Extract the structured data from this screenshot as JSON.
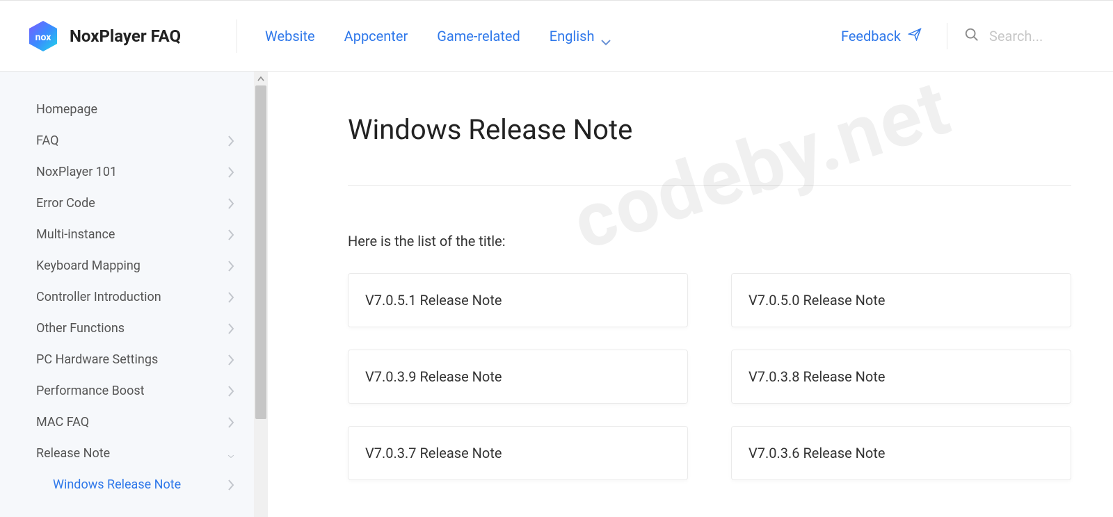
{
  "header": {
    "logo_text": "NoxPlayer FAQ",
    "nav": {
      "website": "Website",
      "appcenter": "Appcenter",
      "game_related": "Game-related",
      "language": "English"
    },
    "feedback": "Feedback",
    "search_placeholder": "Search..."
  },
  "sidebar": {
    "items": [
      {
        "label": "Homepage",
        "expandable": false
      },
      {
        "label": "FAQ",
        "expandable": true
      },
      {
        "label": "NoxPlayer 101",
        "expandable": true
      },
      {
        "label": "Error Code",
        "expandable": true
      },
      {
        "label": "Multi-instance",
        "expandable": true
      },
      {
        "label": "Keyboard Mapping",
        "expandable": true
      },
      {
        "label": "Controller Introduction",
        "expandable": true
      },
      {
        "label": "Other Functions",
        "expandable": true
      },
      {
        "label": "PC Hardware Settings",
        "expandable": true
      },
      {
        "label": "Performance Boost",
        "expandable": true
      },
      {
        "label": "MAC FAQ",
        "expandable": true
      },
      {
        "label": "Release Note",
        "expandable": true,
        "expanded": true
      }
    ],
    "sub_item": "Windows Release Note"
  },
  "main": {
    "title": "Windows Release Note",
    "intro": "Here is the list of the title:",
    "cards": [
      "V7.0.5.1 Release Note",
      "V7.0.5.0 Release Note",
      "V7.0.3.9 Release Note",
      "V7.0.3.8 Release Note",
      "V7.0.3.7 Release Note",
      "V7.0.3.6 Release Note"
    ]
  },
  "watermark": "codeby.net"
}
